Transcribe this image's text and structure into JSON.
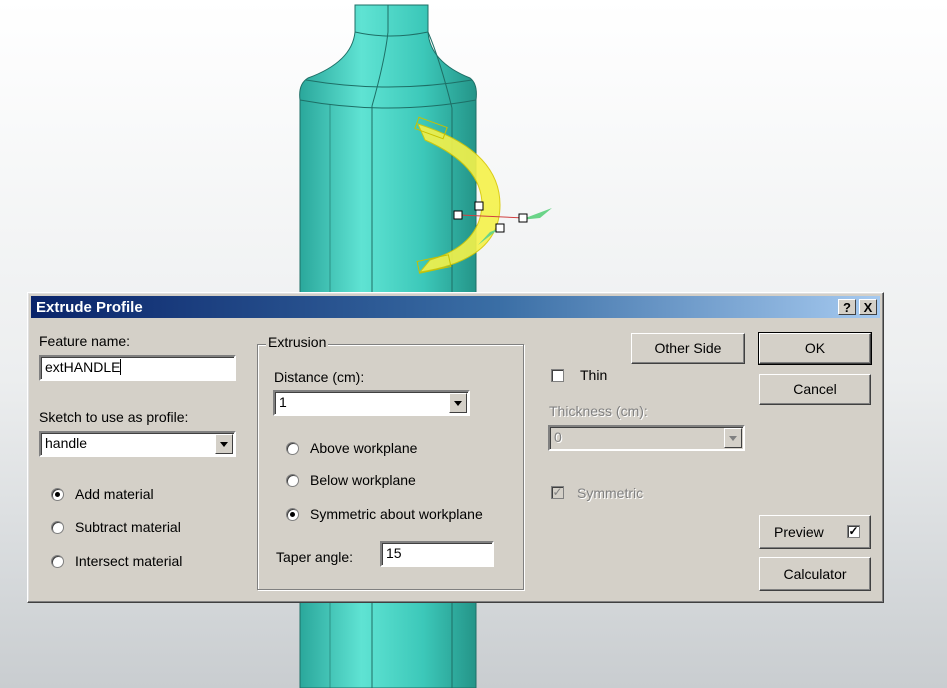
{
  "dialog": {
    "title": "Extrude Profile",
    "help_btn": "?",
    "close_btn": "X"
  },
  "feature_name": {
    "label": "Feature name:",
    "value": "extHANDLE"
  },
  "sketch": {
    "label": "Sketch to use as profile:",
    "value": "handle"
  },
  "material": {
    "add": "Add material",
    "subtract": "Subtract material",
    "intersect": "Intersect material",
    "selected": "add"
  },
  "extrusion": {
    "group_label": "Extrusion",
    "distance_label": "Distance (cm):",
    "distance_value": "1",
    "above": "Above workplane",
    "below": "Below workplane",
    "symmetric": "Symmetric about workplane",
    "selected": "symmetric",
    "taper_label": "Taper angle:",
    "taper_value": "15"
  },
  "thin": {
    "label": "Thin",
    "checked": false,
    "thickness_label": "Thickness (cm):",
    "thickness_value": "0",
    "symmetric_label": "Symmetric",
    "symmetric_checked": true
  },
  "buttons": {
    "other_side": "Other Side",
    "ok": "OK",
    "cancel": "Cancel",
    "preview": "Preview",
    "preview_checked": true,
    "calculator": "Calculator"
  },
  "colors": {
    "bottle": "#3cc8b9",
    "handle": "#f5f24a",
    "titlebar": "#0a246a",
    "dialog": "#d4d0c8"
  }
}
